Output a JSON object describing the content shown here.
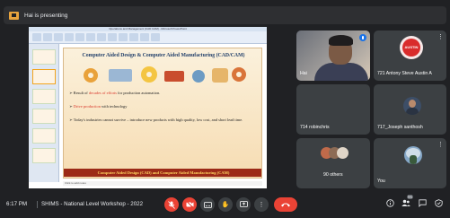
{
  "banner": {
    "text": "Hai is presenting",
    "icon": "present-icon"
  },
  "slide": {
    "title": "Computer Aided Design & Computer Aided Manufacturing (CAD/CAM)",
    "bullets": [
      {
        "prefix": "Result of ",
        "emphasis": "decades of efforts",
        "suffix": " for production automation."
      },
      {
        "prefix": "",
        "emphasis": "Drive production",
        "suffix": " with technology"
      },
      {
        "prefix": "Today's industries cannot survive – introduce new products with high quality, low cost, and short lead time.",
        "emphasis": "",
        "suffix": ""
      }
    ],
    "footer": "Computer Aided Design (CAD) and Computer Aided Manufacturing (CAM)",
    "notes": "Click to add notes",
    "window_title": "Operations and Management (CAD CAM) - Microsoft PowerPoint"
  },
  "participants": [
    {
      "name": "Hai",
      "type": "video"
    },
    {
      "name": "721 Antony Steve Austin A",
      "type": "avatar",
      "avatar_text": "AUSTIN"
    },
    {
      "name": "714 robinchris",
      "type": "blank"
    },
    {
      "name": "717_Joseph santhosh",
      "type": "avatar"
    },
    {
      "name": "90 others",
      "type": "group"
    },
    {
      "name": "You",
      "type": "avatar"
    }
  ],
  "bottom_bar": {
    "time": "6:17 PM",
    "meeting_name": "SHIMS - National Level Workshop - 2022",
    "participant_count": "96",
    "controls": [
      "mic-off-icon",
      "camera-off-icon",
      "captions-icon",
      "raise-hand-icon",
      "present-icon",
      "more-icon",
      "end-call-icon"
    ],
    "right_controls": [
      "info-icon",
      "people-icon",
      "chat-icon",
      "activities-icon"
    ]
  },
  "colors": {
    "background": "#202124",
    "tile": "#3c4043",
    "danger": "#ea4335",
    "accent": "#1a73e8"
  }
}
